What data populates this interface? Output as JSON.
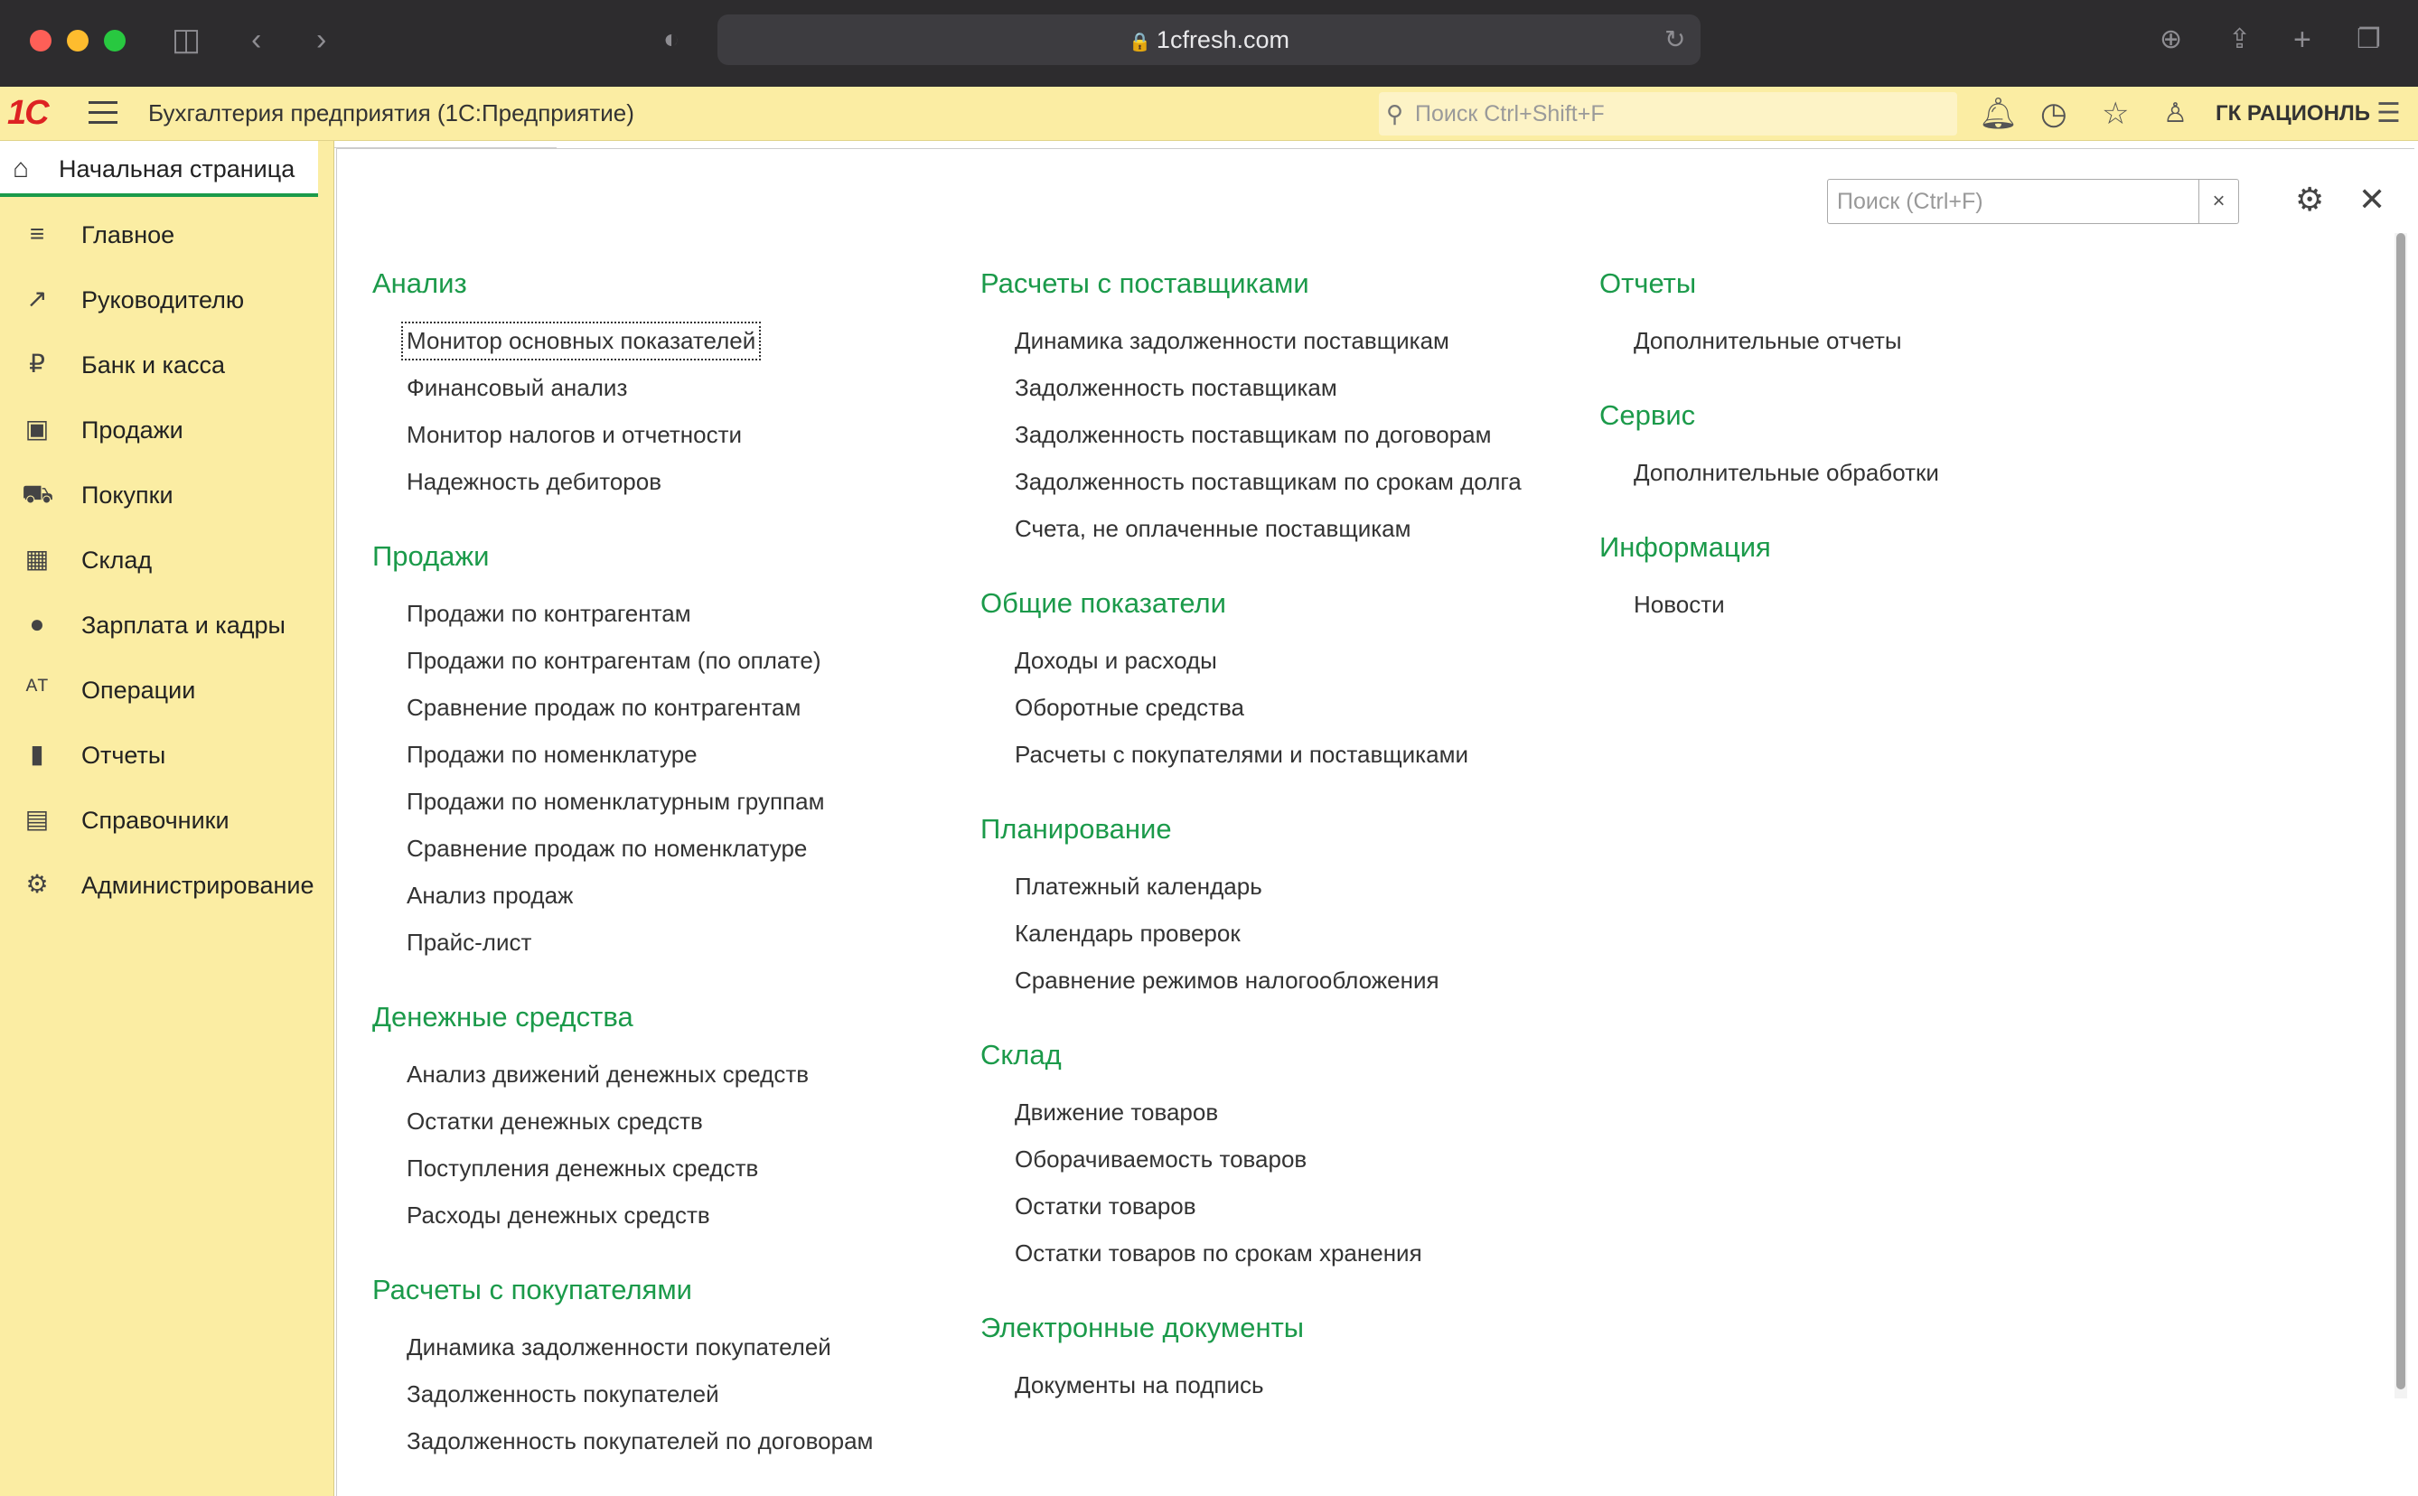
{
  "browser": {
    "url": "1cfresh.com",
    "icons": [
      "sidebar-icon",
      "back-icon",
      "forward-icon",
      "shield-icon",
      "reload-icon",
      "download-icon",
      "share-icon",
      "new-tab-icon",
      "tabs-icon"
    ]
  },
  "header": {
    "logo": "1С",
    "title": "Бухгалтерия предприятия  (1С:Предприятие)",
    "search_placeholder": "Поиск Ctrl+Shift+F",
    "org": "ГК РАЦИОНЛЬ"
  },
  "sidebar": {
    "home": "Начальная страница",
    "items": [
      {
        "label": "Главное",
        "icon": "list-icon"
      },
      {
        "label": "Руководителю",
        "icon": "trend-icon"
      },
      {
        "label": "Банк и касса",
        "icon": "ruble-icon"
      },
      {
        "label": "Продажи",
        "icon": "bag-icon"
      },
      {
        "label": "Покупки",
        "icon": "cart-icon"
      },
      {
        "label": "Склад",
        "icon": "grid-icon"
      },
      {
        "label": "Зарплата и кадры",
        "icon": "person-icon"
      },
      {
        "label": "Операции",
        "icon": "dtkt-icon"
      },
      {
        "label": "Отчеты",
        "icon": "bar-chart-icon"
      },
      {
        "label": "Справочники",
        "icon": "books-icon"
      },
      {
        "label": "Администрирование",
        "icon": "gear-icon"
      }
    ]
  },
  "panel": {
    "search_placeholder": "Поиск (Ctrl+F)",
    "clear": "×",
    "columns": [
      [
        {
          "title": "Анализ",
          "links": [
            "Монитор основных показателей",
            "Финансовый анализ",
            "Монитор налогов и отчетности",
            "Надежность дебиторов"
          ]
        },
        {
          "title": "Продажи",
          "links": [
            "Продажи по контрагентам",
            "Продажи по контрагентам (по оплате)",
            "Сравнение продаж по контрагентам",
            "Продажи по номенклатуре",
            "Продажи по номенклатурным группам",
            "Сравнение продаж по номенклатуре",
            "Анализ продаж",
            "Прайс-лист"
          ]
        },
        {
          "title": "Денежные средства",
          "links": [
            "Анализ движений денежных средств",
            "Остатки денежных средств",
            "Поступления денежных средств",
            "Расходы денежных средств"
          ]
        },
        {
          "title": "Расчеты с покупателями",
          "links": [
            "Динамика задолженности покупателей",
            "Задолженность покупателей",
            "Задолженность покупателей по договорам"
          ]
        }
      ],
      [
        {
          "title": "Расчеты с поставщиками",
          "links": [
            "Динамика задолженности поставщикам",
            "Задолженность поставщикам",
            "Задолженность поставщикам по договорам",
            "Задолженность поставщикам по срокам долга",
            "Счета, не оплаченные поставщикам"
          ]
        },
        {
          "title": "Общие показатели",
          "links": [
            "Доходы и расходы",
            "Оборотные средства",
            "Расчеты с покупателями и поставщиками"
          ]
        },
        {
          "title": "Планирование",
          "links": [
            "Платежный календарь",
            "Календарь проверок",
            "Сравнение режимов налогообложения"
          ]
        },
        {
          "title": "Склад",
          "links": [
            "Движение товаров",
            "Оборачиваемость товаров",
            "Остатки товаров",
            "Остатки товаров по срокам хранения"
          ]
        },
        {
          "title": "Электронные документы",
          "links": [
            "Документы на подпись"
          ]
        }
      ],
      [
        {
          "title": "Отчеты",
          "links": [
            "Дополнительные отчеты"
          ]
        },
        {
          "title": "Сервис",
          "links": [
            "Дополнительные обработки"
          ]
        },
        {
          "title": "Информация",
          "links": [
            "Новости"
          ]
        }
      ]
    ]
  },
  "colors": {
    "accent_green": "#1b9a4a",
    "header_yellow": "#fbeda3"
  }
}
